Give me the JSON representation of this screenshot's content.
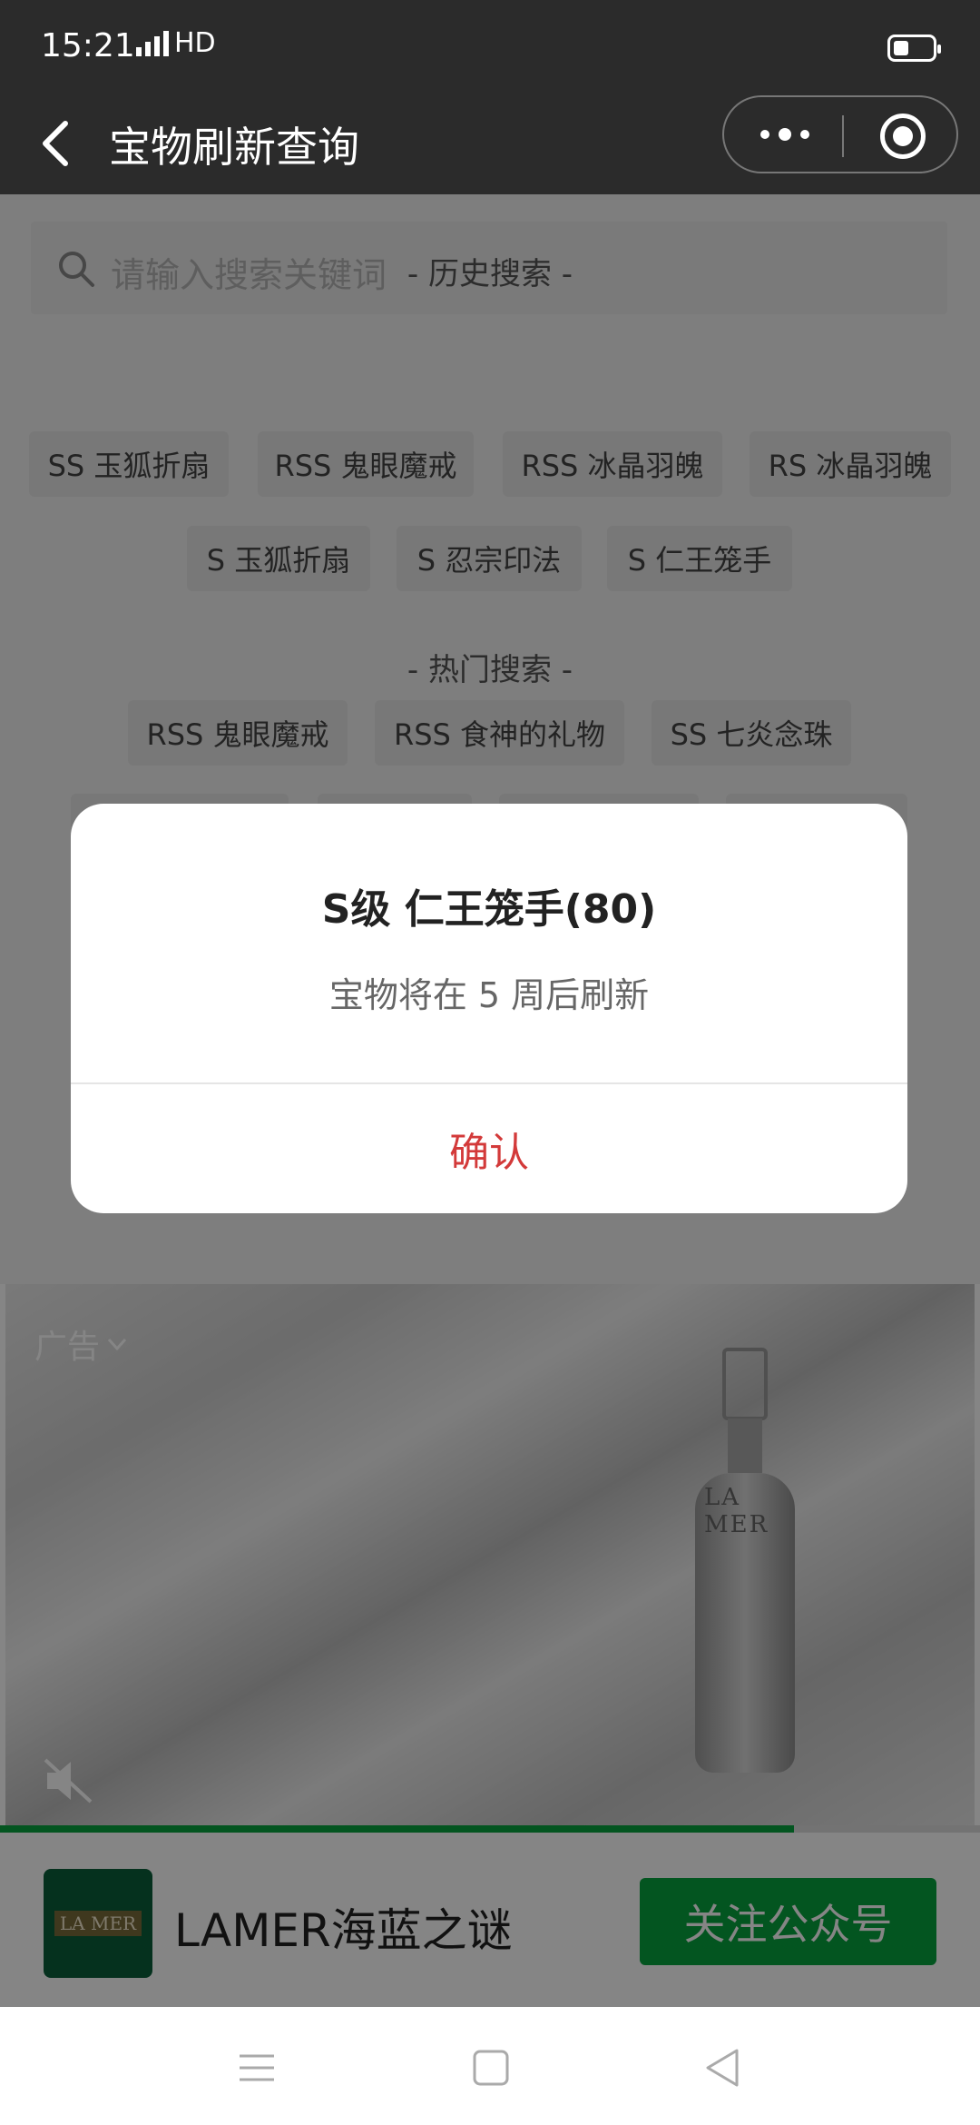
{
  "status_bar": {
    "time": "15:21",
    "network": "HD"
  },
  "nav": {
    "title": "宝物刷新查询"
  },
  "search": {
    "placeholder": "请输入搜索关键词"
  },
  "history": {
    "title": "- 历史搜索 -",
    "tags": [
      "SS 玉狐折扇",
      "RSS 鬼眼魔戒",
      "RSS 冰晶羽魄",
      "RS 冰晶羽魄",
      "S 玉狐折扇",
      "S 忍宗印法",
      "S 仁王笼手"
    ]
  },
  "hot": {
    "title": "- 热门搜索 -",
    "tags": [
      "RSS 鬼眼魔戒",
      "RSS 食神的礼物",
      "SS 七炎念珠"
    ]
  },
  "dialog": {
    "title": "S级 仁王笼手(80)",
    "message": "宝物将在 5 周后刷新",
    "confirm": "确认"
  },
  "ad": {
    "label": "广告",
    "bottle_text": "LA MER",
    "logo_text": "LA MER",
    "name": "LAMER海蓝之谜",
    "follow_button": "关注公众号",
    "progress": 0.81
  },
  "icons": [
    "back-icon",
    "more-icon",
    "target-icon",
    "search-icon",
    "chevron-down-icon",
    "mute-icon",
    "menu-icon",
    "home-icon",
    "back-triangle-icon"
  ]
}
